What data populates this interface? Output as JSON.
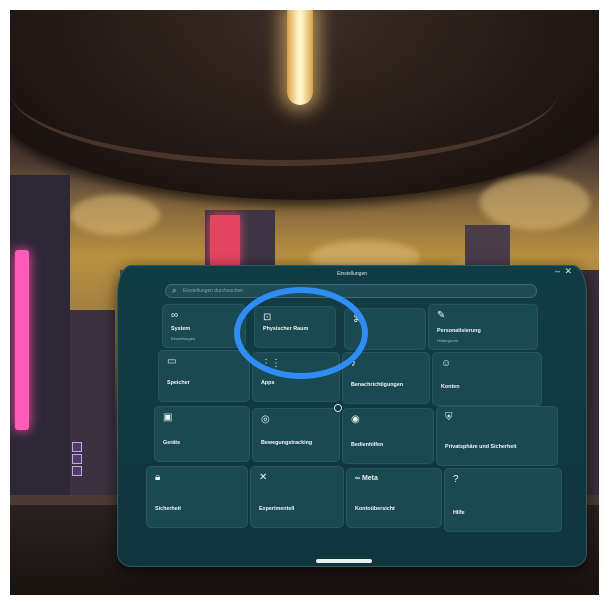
{
  "window": {
    "title": "Einstellungen",
    "close_icon": "close-icon",
    "minimize_icon": "minimize-icon"
  },
  "search": {
    "placeholder": "Einstellungen durchsuchen"
  },
  "tiles": [
    {
      "title": "System",
      "subtitle": "Einstellungen",
      "icon": "infinity-icon"
    },
    {
      "title": "Physischer Raum",
      "subtitle": "",
      "icon": "boundary-icon"
    },
    {
      "title": "",
      "subtitle": "",
      "icon": "link-icon"
    },
    {
      "title": "Personalisierung",
      "subtitle": "Hintergrund",
      "icon": "brush-icon"
    },
    {
      "title": "Speicher",
      "subtitle": "",
      "icon": "storage-icon"
    },
    {
      "title": "Apps",
      "subtitle": "",
      "icon": "apps-icon"
    },
    {
      "title": "Benachrichtigungen",
      "subtitle": "",
      "icon": "bell-icon"
    },
    {
      "title": "Konten",
      "subtitle": "",
      "icon": "accounts-icon"
    },
    {
      "title": "Geräte",
      "subtitle": "",
      "icon": "controller-icon"
    },
    {
      "title": "Bewegungstracking",
      "subtitle": "",
      "icon": "tracking-icon"
    },
    {
      "title": "Bedienhilfen",
      "subtitle": "",
      "icon": "accessibility-icon"
    },
    {
      "title": "Privatsphäre und Sicherheit",
      "subtitle": "",
      "icon": "shield-icon"
    },
    {
      "title": "Sicherheit",
      "subtitle": "",
      "icon": "lock-icon"
    },
    {
      "title": "Experimentell",
      "subtitle": "",
      "icon": "experimental-icon"
    },
    {
      "title": "Kontoübersicht",
      "subtitle": "",
      "icon": "meta-logo",
      "logo_text": "Meta"
    },
    {
      "title": "Hilfe",
      "subtitle": "",
      "icon": "help-icon"
    }
  ],
  "colors": {
    "panel": "#123c45",
    "tile": "#1a4952",
    "highlight": "#2f8df5"
  }
}
